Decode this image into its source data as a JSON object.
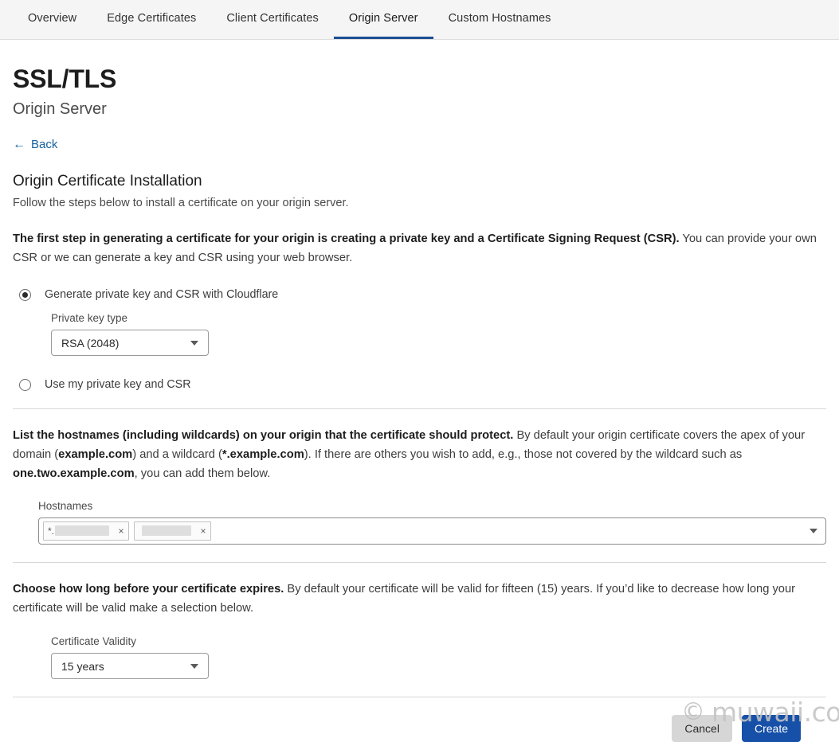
{
  "tabs": [
    {
      "label": "Overview",
      "active": false
    },
    {
      "label": "Edge Certificates",
      "active": false
    },
    {
      "label": "Client Certificates",
      "active": false
    },
    {
      "label": "Origin Server",
      "active": true
    },
    {
      "label": "Custom Hostnames",
      "active": false
    }
  ],
  "header": {
    "title": "SSL/TLS",
    "subtitle": "Origin Server",
    "back_arrow": "←",
    "back_label": "Back"
  },
  "install": {
    "heading": "Origin Certificate Installation",
    "description": "Follow the steps below to install a certificate on your origin server."
  },
  "step_csr": {
    "bold_lead": "The first step in generating a certificate for your origin is creating a private key and a Certificate Signing Request (CSR).",
    "rest": " You can provide your own CSR or we can generate a key and CSR using your web browser.",
    "options": [
      {
        "label": "Generate private key and CSR with Cloudflare",
        "selected": true
      },
      {
        "label": "Use my private key and CSR",
        "selected": false
      }
    ],
    "private_key_type_label": "Private key type",
    "private_key_type_value": "RSA (2048)"
  },
  "step_hostnames": {
    "bold_lead": "List the hostnames (including wildcards) on your origin that the certificate should protect.",
    "text_1": " By default your origin certificate covers the apex of your domain (",
    "bold_1": "example.com",
    "text_2": ") and a wildcard (",
    "bold_2": "*.example.com",
    "text_3": "). If there are others you wish to add, e.g., those not covered by the wildcard such as ",
    "bold_3": "one.two.example.com",
    "text_4": ", you can add them below.",
    "field_label": "Hostnames",
    "tags": [
      {
        "prefix": "*.",
        "value": "",
        "remove_label": "×",
        "redacted": true
      },
      {
        "prefix": "",
        "value": "",
        "remove_label": "×",
        "redacted": true
      }
    ]
  },
  "step_validity": {
    "bold_lead": "Choose how long before your certificate expires.",
    "rest": " By default your certificate will be valid for fifteen (15) years. If you’d like to decrease how long your certificate will be valid make a selection below.",
    "field_label": "Certificate Validity",
    "value": "15 years"
  },
  "footer": {
    "cancel_label": "Cancel",
    "create_label": "Create"
  },
  "watermark": {
    "copyright": "©",
    "text": "muwaii.com"
  },
  "colors": {
    "accent": "#1b4f96",
    "primary_button": "#1650a8",
    "link": "#16619e",
    "tabbar_bg": "#f5f5f5"
  }
}
